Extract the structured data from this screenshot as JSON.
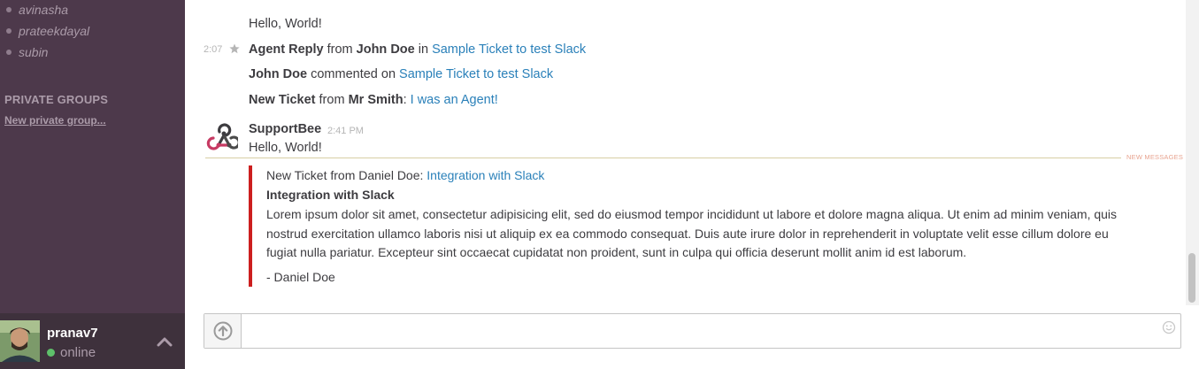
{
  "sidebar": {
    "direct_messages": [
      "avinasha",
      "prateekdayal",
      "subin"
    ],
    "private_groups_header": "PRIVATE GROUPS",
    "new_private_group": "New private group...",
    "user": {
      "name": "pranav7",
      "status": "online"
    }
  },
  "messages": {
    "hello_1": "Hello, World!",
    "agent_reply": {
      "time": "2:07",
      "bold1": "Agent Reply",
      "from": " from ",
      "bold2": "John Doe",
      "in": " in ",
      "link": "Sample Ticket to test Slack"
    },
    "comment": {
      "bold": "John Doe",
      "text": " commented on ",
      "link": "Sample Ticket to test Slack"
    },
    "new_ticket": {
      "bold1": "New Ticket",
      "from": " from ",
      "bold2": "Mr Smith",
      "sep": ": ",
      "link": "I was an Agent!"
    },
    "supportbee": {
      "name": "SupportBee",
      "time": "2:41 PM",
      "text": "Hello, World!"
    },
    "new_messages_label": "NEW MESSAGES",
    "attachment": {
      "pretext": "New Ticket from Daniel Doe: ",
      "link": "Integration with Slack",
      "title": "Integration with Slack",
      "body": "Lorem ipsum dolor sit amet, consectetur adipisicing elit, sed do eiusmod tempor incididunt ut labore et dolore magna aliqua. Ut enim ad minim veniam, quis nostrud exercitation ullamco laboris nisi ut aliquip ex ea commodo consequat. Duis aute irure dolor in reprehenderit in voluptate velit esse cillum dolore eu fugiat nulla pariatur. Excepteur sint occaecat cupidatat non proident, sunt in culpa qui officia deserunt mollit anim id est laborum.",
      "signature": "- Daniel Doe",
      "accent_color": "#cc1f1f"
    }
  },
  "composer": {
    "value": ""
  },
  "colors": {
    "sidebar": "#4d394b",
    "link": "#2a80b9"
  }
}
